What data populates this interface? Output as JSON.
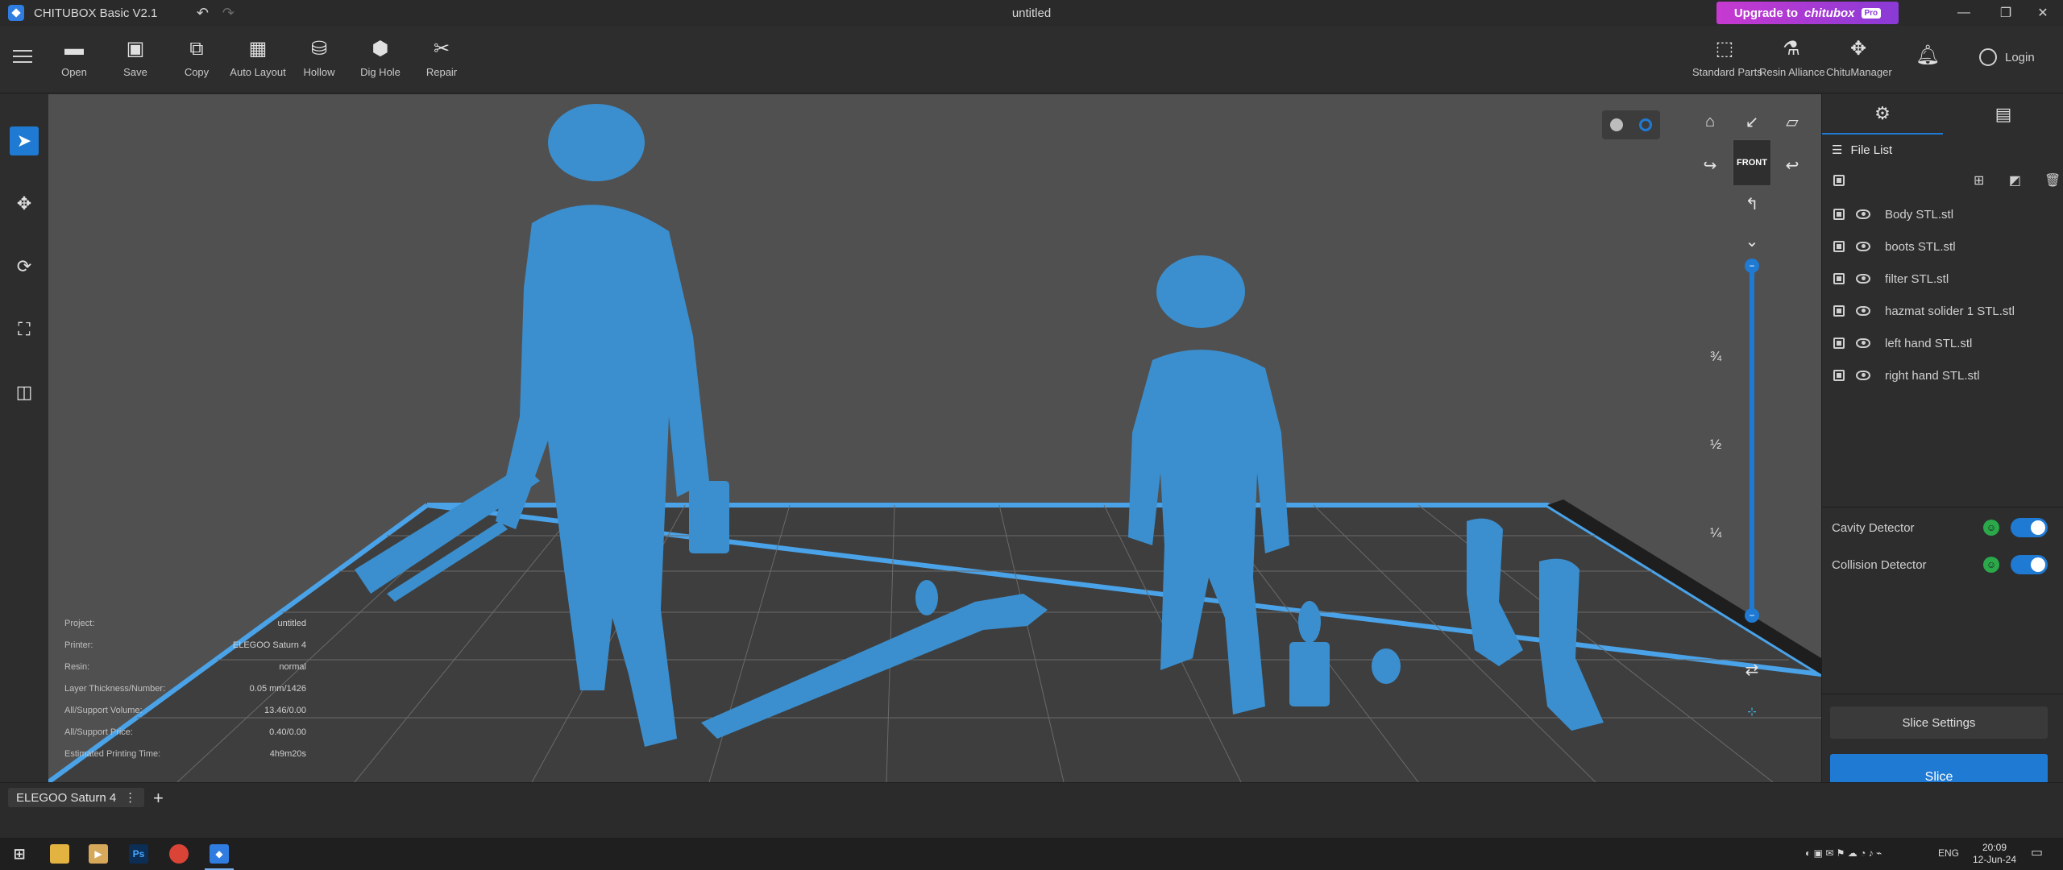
{
  "titlebar": {
    "app_name": "CHITUBOX Basic V2.1",
    "doc_title": "untitled",
    "upgrade_label": "Upgrade to",
    "upgrade_brand": "chitubox",
    "upgrade_badge": "Pro"
  },
  "toolbar": {
    "tools": [
      {
        "label": "Open",
        "icon": "folder-icon"
      },
      {
        "label": "Save",
        "icon": "save-icon"
      },
      {
        "label": "Copy",
        "icon": "copy-icon"
      },
      {
        "label": "Auto Layout",
        "icon": "auto-layout-icon"
      },
      {
        "label": "Hollow",
        "icon": "hollow-icon"
      },
      {
        "label": "Dig Hole",
        "icon": "dig-hole-icon"
      },
      {
        "label": "Repair",
        "icon": "repair-icon"
      }
    ],
    "right_tools": [
      {
        "label": "Standard Parts",
        "icon": "standard-parts-icon"
      },
      {
        "label": "Resin Alliance",
        "icon": "resin-alliance-icon"
      },
      {
        "label": "ChituManager",
        "icon": "chitumanager-icon"
      }
    ],
    "login_label": "Login"
  },
  "viewport": {
    "cube_label": "FRONT",
    "slider_fractions": [
      "¾",
      "½",
      "¼"
    ],
    "model_color": "#3b8fcf",
    "plate_border_color": "#4aa3e8",
    "info": [
      {
        "key": "Project:",
        "value": "untitled"
      },
      {
        "key": "Printer:",
        "value": "ELEGOO Saturn 4"
      },
      {
        "key": "Resin:",
        "value": "normal"
      },
      {
        "key": "Layer Thickness/Number:",
        "value": "0.05 mm/1426"
      },
      {
        "key": "All/Support Volume:",
        "value": "13.46/0.00"
      },
      {
        "key": "All/Support Price:",
        "value": "0.40/0.00"
      },
      {
        "key": "Estimated Printing Time:",
        "value": "4h9m20s"
      }
    ]
  },
  "panel": {
    "file_list_title": "File List",
    "files": [
      "Body STL.stl",
      "boots STL.stl",
      "filter STL.stl",
      "hazmat solider 1 STL.stl",
      "left hand STL.stl",
      "right hand STL.stl"
    ],
    "detectors": [
      {
        "label": "Cavity Detector",
        "enabled": true
      },
      {
        "label": "Collision Detector",
        "enabled": true
      }
    ],
    "slice_settings_label": "Slice Settings",
    "slice_label": "Slice"
  },
  "printer_tab": {
    "label": "ELEGOO Saturn 4",
    "add_label": "+"
  },
  "taskbar": {
    "lang": "ENG",
    "time": "20:09",
    "date": "12-Jun-24"
  },
  "colors": {
    "accent": "#1f7ad4",
    "upgrade_gradient_start": "#c63ad0",
    "upgrade_gradient_end": "#8a3ad6"
  }
}
